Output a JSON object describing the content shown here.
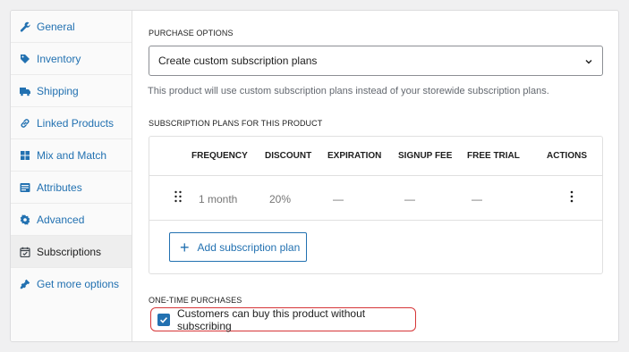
{
  "sidebar": {
    "items": [
      {
        "label": "General",
        "icon": "wrench-icon",
        "active": false
      },
      {
        "label": "Inventory",
        "icon": "tag-icon",
        "active": false
      },
      {
        "label": "Shipping",
        "icon": "truck-icon",
        "active": false
      },
      {
        "label": "Linked Products",
        "icon": "link-icon",
        "active": false
      },
      {
        "label": "Mix and Match",
        "icon": "grid-icon",
        "active": false
      },
      {
        "label": "Attributes",
        "icon": "list-icon",
        "active": false
      },
      {
        "label": "Advanced",
        "icon": "gear-icon",
        "active": false
      },
      {
        "label": "Subscriptions",
        "icon": "calendar-check-icon",
        "active": true
      },
      {
        "label": "Get more options",
        "icon": "plugin-icon",
        "active": false
      }
    ]
  },
  "purchase_options": {
    "label": "PURCHASE OPTIONS",
    "selected": "Create custom subscription plans",
    "helper": "This product will use custom subscription plans instead of your storewide subscription plans."
  },
  "plans": {
    "label": "SUBSCRIPTION PLANS FOR THIS PRODUCT",
    "headers": {
      "frequency": "FREQUENCY",
      "discount": "DISCOUNT",
      "expiration": "EXPIRATION",
      "signup_fee": "SIGNUP FEE",
      "free_trial": "FREE TRIAL",
      "actions": "ACTIONS"
    },
    "rows": [
      {
        "frequency": "1 month",
        "discount": "20%",
        "expiration": "—",
        "signup_fee": "—",
        "free_trial": "—"
      }
    ],
    "add_label": "Add subscription plan"
  },
  "one_time": {
    "label": "ONE-TIME PURCHASES",
    "checkbox_label": "Customers can buy this product without subscribing",
    "checked": true
  },
  "colors": {
    "accent": "#2271b1",
    "highlight": "#d63638"
  }
}
